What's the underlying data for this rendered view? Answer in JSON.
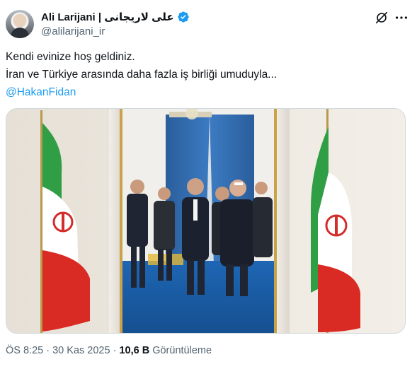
{
  "author": {
    "display_name": "Ali Larijani | علی لاریجانی",
    "handle": "@alilarijani_ir",
    "verified": true
  },
  "icons": {
    "avatar": "profile-photo",
    "verified": "verified-badge-icon",
    "grok": "grok-icon",
    "more": "more-options-icon"
  },
  "tweet": {
    "line1": "Kendi evinize hoş geldiniz.",
    "line2": "İran ve Türkiye arasında daha fazla iş birliği umuduyla...",
    "mention": "@HakanFidan"
  },
  "media": {
    "description_visible": false,
    "flag_colors": {
      "green": "#2f9e44",
      "white": "#ffffff",
      "red": "#da2a24",
      "emblem": "#d42b2b"
    },
    "carpet_color": "#1a5aa8",
    "curtain_color": "#2f6ab0"
  },
  "meta": {
    "time": "ÖS 8:25",
    "separator": "·",
    "date": "30 Kas 2025",
    "views_count": "10,6 B",
    "views_label": "Görüntüleme"
  },
  "colors": {
    "text": "#0f1419",
    "secondary": "#536471",
    "accent": "#1d9bf0"
  }
}
